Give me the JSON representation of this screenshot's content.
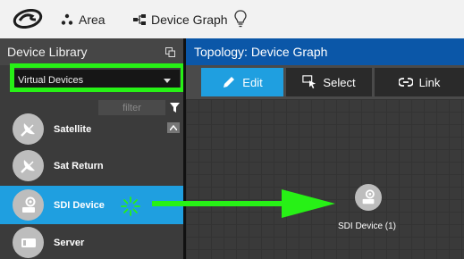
{
  "topbar": {
    "logo_icon": "gv-logo-icon",
    "area_label": "Area",
    "device_graph_label": "Device Graph"
  },
  "sidebar": {
    "title": "Device Library",
    "selected_library": "Virtual Devices",
    "filter_placeholder": "filter",
    "devices": [
      {
        "label": "Satellite",
        "icon": "satellite-dish-icon"
      },
      {
        "label": "Sat Return",
        "icon": "satellite-dish-icon"
      },
      {
        "label": "SDI Device",
        "icon": "sdi-device-icon",
        "selected": true
      },
      {
        "label": "Server",
        "icon": "server-icon"
      }
    ]
  },
  "topology": {
    "title": "Topology: Device Graph",
    "toolbar": {
      "edit_label": "Edit",
      "select_label": "Select",
      "link_label": "Link"
    },
    "node_label": "SDI Device (1)"
  },
  "colors": {
    "accent_blue": "#1f9fe0",
    "header_blue": "#0b57a8",
    "highlight_green": "#27f116",
    "sidebar_bg": "#3b3b3b",
    "canvas_bg": "#3a3a3a"
  }
}
